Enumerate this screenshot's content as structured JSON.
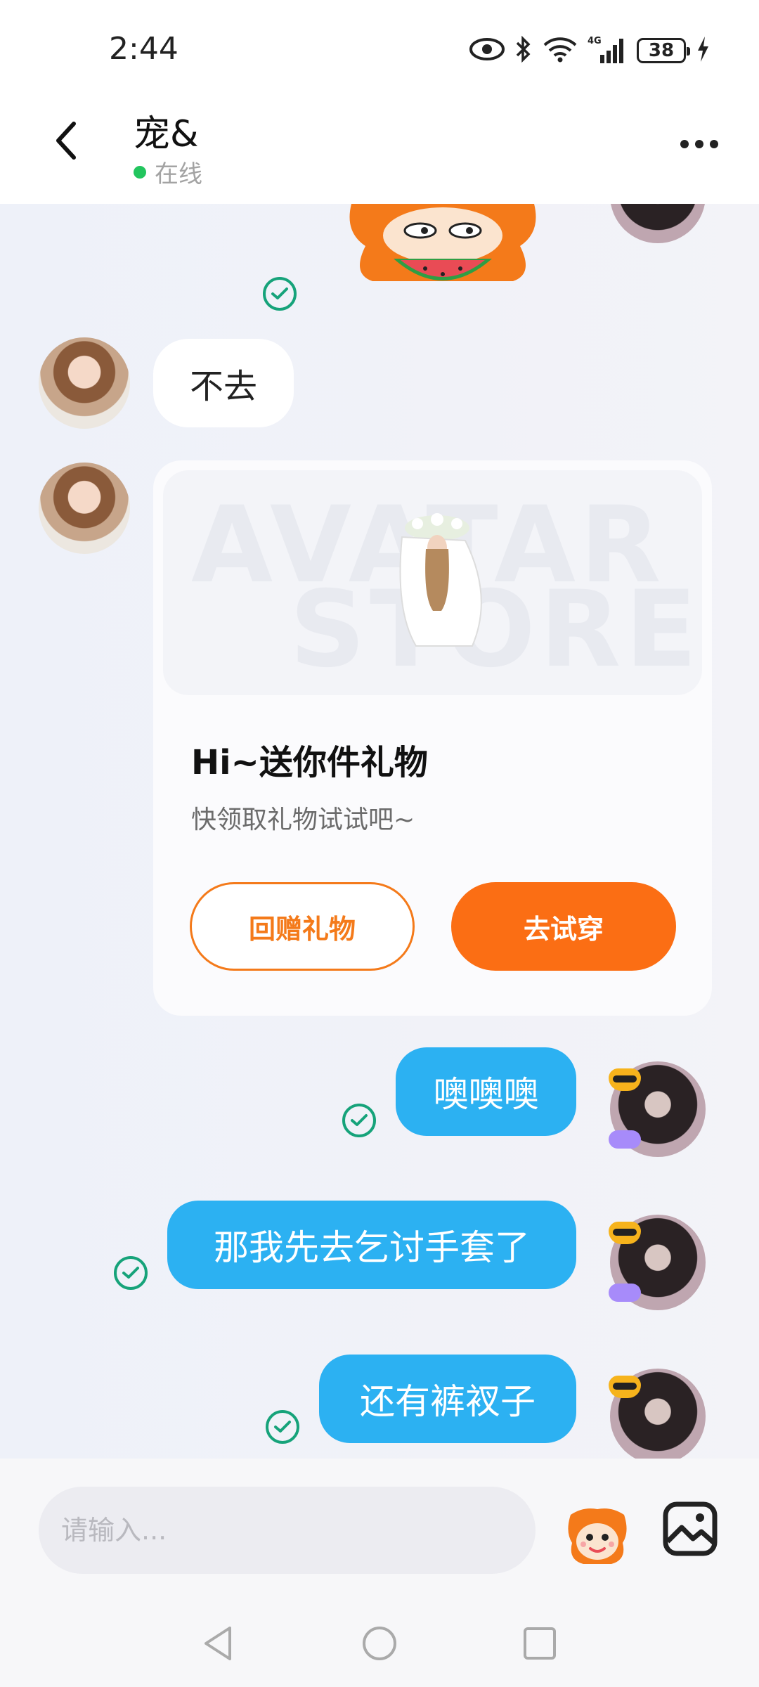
{
  "status_bar": {
    "time": "2:44",
    "battery": "38",
    "signal_label": "4G"
  },
  "header": {
    "contact_name": "宠&",
    "status": "在线"
  },
  "messages": [
    {
      "side": "left",
      "text": "不去"
    },
    {
      "side": "right",
      "text": "噢噢噢"
    },
    {
      "side": "right",
      "text": "那我先去乞讨手套了"
    },
    {
      "side": "right",
      "text": "还有裤衩子"
    }
  ],
  "gift_card": {
    "banner_text": [
      "AVATAR",
      "STORE"
    ],
    "title": "Hi~送你件礼物",
    "subtitle": "快领取礼物试试吧~",
    "return_gift_label": "回赠礼物",
    "try_on_label": "去试穿"
  },
  "composer": {
    "placeholder": "请输入..."
  },
  "icons": {
    "back": "chevron-left-icon",
    "more": "more-dots-icon",
    "read_receipt": "check-circle-icon",
    "sticker": "mascot-sticker-icon",
    "gallery": "image-icon"
  },
  "colors": {
    "accent_orange": "#fb6e14",
    "bubble_blue": "#2cb1f2",
    "check_green": "#16a37a",
    "online_green": "#22c55e"
  }
}
